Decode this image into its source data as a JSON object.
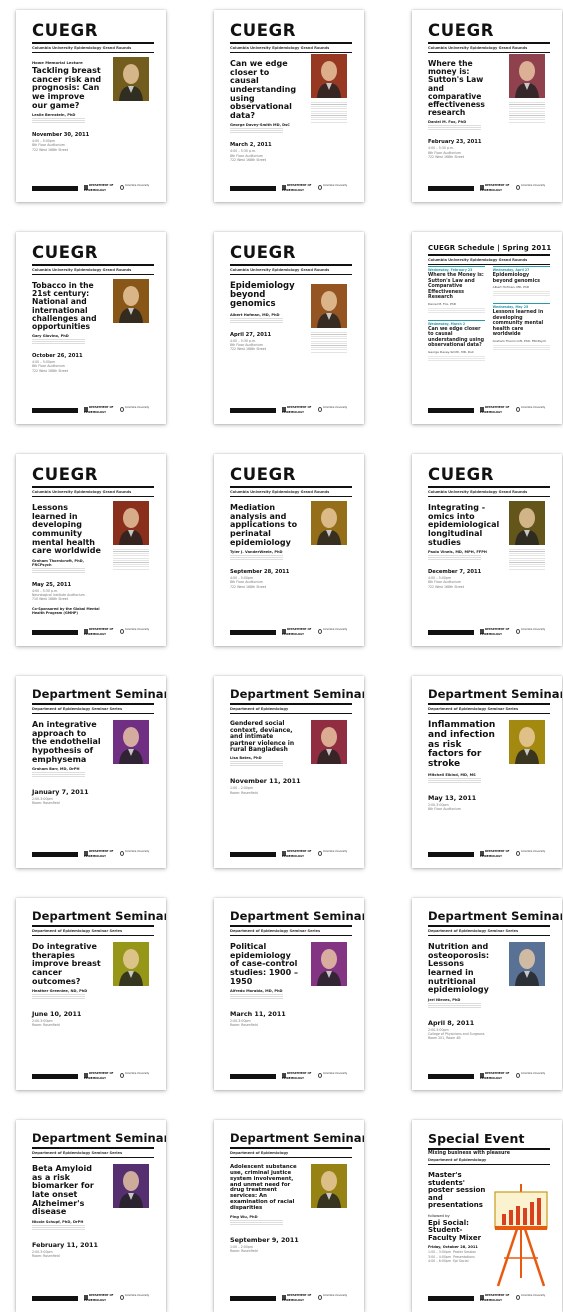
{
  "footer": {
    "dept_label": "DEPARTMENT OF EPIDEMIOLOGY",
    "univ_label": "Columbia University"
  },
  "posters": [
    {
      "kind": "cuegr",
      "series": "CUEGR",
      "subtitle": "Columbia University Epidemiology Grand Rounds",
      "kicker": "Howe Memorial Lecture",
      "title": "Tackling breast cancer risk and prognosis: Can we improve our game?",
      "speaker": "Leslie Bernstein, PhD",
      "date": "November 30, 2011",
      "details": "4:00 – 5:00pm\n8th Floor Auditorium\n722 West 168th Street",
      "photo_color": "#8c7226",
      "photo_side": "right"
    },
    {
      "kind": "cuegr",
      "series": "CUEGR",
      "subtitle": "Columbia University Epidemiology Grand Rounds",
      "title": "Can we edge closer to causal understanding using observational data?",
      "speaker": "George Davey-Smith MD, DsC",
      "date": "March 2, 2011",
      "details": "4:00 – 5:30 p.m.\n8th Floor Auditorium\n722 West 168th Street",
      "photo_color": "#b8452a",
      "photo_side": "right-top"
    },
    {
      "kind": "cuegr",
      "series": "CUEGR",
      "subtitle": "Columbia University Epidemiology Grand Rounds",
      "title": "Where the money is: Sutton's Law and comparative effectiveness research",
      "speaker": "Daniel M. Fox, PhD",
      "date": "February 23, 2011",
      "details": "4:00 – 5:30 p.m.\n8th Floor Auditorium\n722 West 168th Street",
      "photo_color": "#b05060",
      "photo_side": "right-top"
    },
    {
      "kind": "cuegr",
      "series": "CUEGR",
      "subtitle": "Columbia University Epidemiology Grand Rounds",
      "title": "Tobacco in the 21st century: National and international challenges and opportunities",
      "speaker": "Gary Giovino, PhD",
      "date": "October 26, 2011",
      "details": "4:00 – 5:00pm\n8th Floor Auditorium\n722 West 168th Street",
      "photo_color": "#a66b1e",
      "photo_side": "right"
    },
    {
      "kind": "cuegr",
      "series": "CUEGR",
      "subtitle": "Columbia University Epidemiology Grand Rounds",
      "title": "Epidemiology beyond genomics",
      "speaker": "Albert Hofman, MD, PhD",
      "date": "April 27, 2011",
      "details": "4:00 – 5:30 p.m.\n8th Floor Auditorium\n722 West 168th Street",
      "photo_color": "#b5682a",
      "photo_side": "right-low"
    },
    {
      "kind": "schedule",
      "series": "CUEGR Schedule | Spring 2011",
      "subtitle": "Columbia University Epidemiology Grand Rounds",
      "left": [
        {
          "date": "Wednesday, February 23",
          "title": "Where the Money is: Sutton's Law and Comparative Effectiveness Research",
          "speaker": "Daniel M. Fox, PhD"
        },
        {
          "date": "Wednesday, March 2",
          "title": "Can we edge closer to causal understanding using observational data?",
          "speaker": "George Davey-Smith, MD, DsC"
        }
      ],
      "right": [
        {
          "date": "Wednesday, April 27",
          "title": "Epidemiology beyond genomics",
          "speaker": "Albert Hofman, MD, PhD"
        },
        {
          "date": "Wednesday, May 25",
          "title": "Lessons learned in developing community mental health care worldwide",
          "speaker": "Graham Thornicroft, PhD, FRCPsych"
        }
      ]
    },
    {
      "kind": "cuegr",
      "series": "CUEGR",
      "subtitle": "Columbia University Epidemiology Grand Rounds",
      "title": "Lessons learned in developing community mental health care worldwide",
      "speaker": "Graham Thornicroft, PhD, FRCPsych",
      "date": "May 25, 2011",
      "details": "4:00 – 5:30 p.m.\nNeurological Institute Auditorium\n710 West 168th Street",
      "extra": "Co-Sponsored by the Global Mental Health Program (GMHP)",
      "photo_color": "#a83a22",
      "photo_side": "right"
    },
    {
      "kind": "cuegr",
      "series": "CUEGR",
      "subtitle": "Columbia University Epidemiology Grand Rounds",
      "title": "Mediation analysis and applications to perinatal epidemiology",
      "speaker": "Tyler J. VanderWeele, PhD",
      "date": "September 28, 2011",
      "details": "4:00 – 5:00pm\n8th Floor Auditorium\n722 West 168th Street",
      "photo_color": "#b5871e",
      "photo_side": "right"
    },
    {
      "kind": "cuegr",
      "series": "CUEGR",
      "subtitle": "Columbia University Epidemiology Grand Rounds",
      "title": "Integrating -omics into epidemiological longitudinal studies",
      "speaker": "Paolo Vineis, MD, MPH, FFPH",
      "date": "December 7, 2011",
      "details": "4:00 – 5:00pm\n8th Floor Auditorium\n722 West 168th Street",
      "photo_color": "#7a6a22",
      "photo_side": "right"
    },
    {
      "kind": "seminar",
      "series": "Department Seminar",
      "subtitle": "Department of Epidemiology Seminar Series",
      "title": "An integrative approach to the endothelial hypothesis of emphysema",
      "speaker": "Graham Barr, MD, DrPH",
      "date": "January 7, 2011",
      "details": "2:00-3:00pm\nRoom: Rosenfield",
      "photo_color": "#8a3aa0",
      "photo_side": "right"
    },
    {
      "kind": "seminar",
      "series": "Department Seminar",
      "subtitle": "Department of Epidemiology",
      "title": "Gendered social context, deviance, and intimate partner violence in rural Bangladesh",
      "speaker": "Lisa Bates, PhD",
      "date": "November 11, 2011",
      "details": "1:00 – 2:00pm\nRoom: Rosenfield",
      "photo_color": "#b03850",
      "photo_side": "right"
    },
    {
      "kind": "seminar",
      "series": "Department Seminar",
      "subtitle": "Department of Epidemiology Seminar Series",
      "title": "Inflammation and infection as risk factors for stroke",
      "speaker": "Mitchell Elkind, MD, MS",
      "date": "May 13, 2011",
      "details": "2:00-3:00pm\n8th Floor Auditorium",
      "photo_color": "#c9a814",
      "photo_side": "right"
    },
    {
      "kind": "seminar",
      "series": "Department Seminar",
      "subtitle": "Department of Epidemiology Seminar Series",
      "title": "Do integrative therapies improve breast cancer outcomes?",
      "speaker": "Heather Greenlee, ND, PhD",
      "date": "June 10, 2011",
      "details": "2:00-3:00pm\nRoom: Rosenfield",
      "photo_color": "#b8b81e",
      "photo_side": "right"
    },
    {
      "kind": "seminar",
      "series": "Department Seminar",
      "subtitle": "Department of Epidemiology Seminar Series",
      "title": "Political epidemiology of case-control studies: 1900 – 1950",
      "speaker": "Alfredo Morabia, MD, PhD",
      "date": "March 11, 2011",
      "details": "2:00-3:00pm\nRoom: Rosenfield",
      "photo_color": "#a040a0",
      "photo_side": "right"
    },
    {
      "kind": "seminar",
      "series": "Department Seminar",
      "subtitle": "Department of Epidemiology Seminar Series",
      "title": "Nutrition and osteoporosis: Lessons learned in nutritional epidemiology",
      "speaker": "Jeri Nieves, PhD",
      "date": "April 8, 2011",
      "details": "2:00-3:00pm\nCollege of Physicians and Surgeons\nRoom 201, Room 4B",
      "photo_color": "#6e8ab8",
      "photo_side": "right"
    },
    {
      "kind": "seminar",
      "series": "Department Seminar",
      "subtitle": "Department of Epidemiology Seminar Series",
      "title": "Beta Amyloid as a risk biomarker for late onset Alzheimer's disease",
      "speaker": "Nicole Schupf, PhD, DrPH",
      "date": "February 11, 2011",
      "details": "2:00-3:00pm\nRoom: Rosenfield",
      "photo_color": "#6a3a8a",
      "photo_side": "right"
    },
    {
      "kind": "seminar",
      "series": "Department Seminar",
      "subtitle": "Department of Epidemiology",
      "title": "Adolescent substance use, criminal justice system involvement, and unmet need for drug treatment services: An examination of racial disparities",
      "speaker": "Ping Wu, PhD",
      "date": "September 9, 2011",
      "details": "1:00 – 2:00pm\nRoom: Rosenfield",
      "photo_color": "#b8a018",
      "photo_side": "right"
    },
    {
      "kind": "special",
      "series": "Special Event",
      "tagline": "Mixing business with pleasure",
      "subtitle": "Department of Epidemiology",
      "title": "Master's students' poster session and presentations",
      "followed": "followed by",
      "title2": "Epi Social: Student-Faculty Mixer",
      "date": "Friday, October 28, 2011",
      "details": "1:00 – 3:00pm  Poster Session\n3:00 – 4:00pm  Presentations\n4:00 – 6:00pm  Epi Social"
    }
  ]
}
